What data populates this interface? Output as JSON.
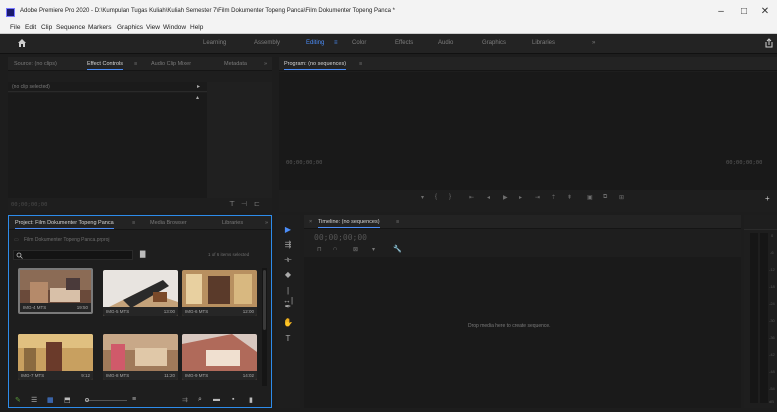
{
  "titlebar": {
    "title": "Adobe Premiere Pro 2020 - D:\\Kumpulan Tugas Kuliah\\Kuliah Semester 7\\Film Dokumenter Topeng Panca\\Film Dokumenter Topeng Panca *",
    "minimize": "–",
    "maximize": "□",
    "close": "✕"
  },
  "menu": [
    "File",
    "Edit",
    "Clip",
    "Sequence",
    "Markers",
    "Graphics",
    "View",
    "Window",
    "Help"
  ],
  "workspaces": [
    {
      "label": "Learning",
      "active": false
    },
    {
      "label": "Assembly",
      "active": false
    },
    {
      "label": "Editing",
      "active": true
    },
    {
      "label": "Color",
      "active": false
    },
    {
      "label": "Effects",
      "active": false
    },
    {
      "label": "Audio",
      "active": false
    },
    {
      "label": "Graphics",
      "active": false
    },
    {
      "label": "Libraries",
      "active": false
    }
  ],
  "workspace_more": "»",
  "effect_panel": {
    "tabs": [
      "Source: (no clips)",
      "Effect Controls",
      "Audio Clip Mixer",
      "Metadata"
    ],
    "active_tab": "Effect Controls",
    "menu_glyph": "≡",
    "more": "»",
    "no_clip": "(no clip selected)",
    "timecode": "00;00;00;00"
  },
  "program_panel": {
    "tab": "Program: (no sequences)",
    "menu_glyph": "≡",
    "timecode_left": "00;00;00;00",
    "timecode_right": "00;00;00;00",
    "add": "+"
  },
  "project_panel": {
    "tabs": [
      "Project: Film Dokumenter Topeng Panca",
      "Media Browser",
      "Libraries"
    ],
    "active_tab": "Project: Film Dokumenter Topeng Panca",
    "more": "»",
    "path": "Film Dokumenter Topeng Panca.prproj",
    "search_placeholder": "",
    "items_selected": "1 of 6 items selected",
    "clips": [
      {
        "name": "IMG-4 MTS",
        "duration": "19:50"
      },
      {
        "name": "IMG-5 MTS",
        "duration": "13:00"
      },
      {
        "name": "IMG-6 MTS",
        "duration": "12:00"
      },
      {
        "name": "IMG-7 MTS",
        "duration": "9:12"
      },
      {
        "name": "IMG-8 MTS",
        "duration": "11:20"
      },
      {
        "name": "IMG-9 MTS",
        "duration": "14:02"
      }
    ]
  },
  "timeline_panel": {
    "tab": "Timeline: (no sequences)",
    "menu_glyph": "≡",
    "close": "×",
    "timecode": "00;00;00;00",
    "drop_text": "Drop media here to create sequence."
  },
  "audio_meter": {
    "scale": [
      "0",
      "-6",
      "-12",
      "-18",
      "-24",
      "-30",
      "-36",
      "-42",
      "-48",
      "-54",
      "dB"
    ]
  },
  "colors": {
    "accent": "#4b8df8",
    "panel_bg": "#1e1e1e",
    "header_bg": "#232323",
    "chrome_bg": "#f3f3f3",
    "selected_border": "#2d8ceb"
  },
  "icons": {
    "home": "home-icon",
    "share": "share-icon",
    "search": "search-icon",
    "new_bin": "new-bin-icon",
    "wrench": "wrench-icon"
  }
}
